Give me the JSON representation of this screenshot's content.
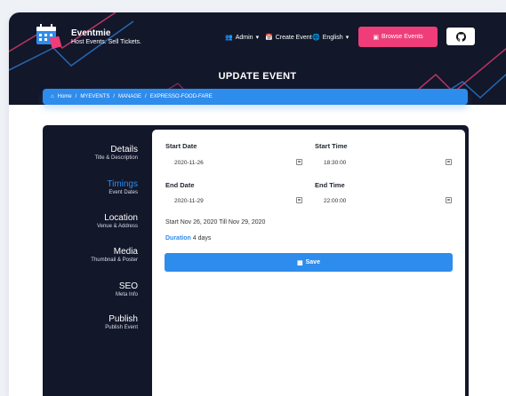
{
  "brand": {
    "name": "Eventmie",
    "tagline": "Host Events. Sell Tickets."
  },
  "nav": {
    "admin": "Admin",
    "create_event": "Create Event",
    "language": "English",
    "browse_events": "Browse Events"
  },
  "page": {
    "title": "UPDATE EVENT"
  },
  "breadcrumb": {
    "items": [
      "Home",
      "MYEVENTS",
      "MANAGE",
      "EXPRESSO-FOOD-FARE"
    ],
    "sep": "/"
  },
  "sidebar": {
    "items": [
      {
        "title": "Details",
        "subtitle": "Title & Description",
        "active": false
      },
      {
        "title": "Timings",
        "subtitle": "Event Dates",
        "active": true
      },
      {
        "title": "Location",
        "subtitle": "Venue & Address",
        "active": false
      },
      {
        "title": "Media",
        "subtitle": "Thumbnail & Poster",
        "active": false
      },
      {
        "title": "SEO",
        "subtitle": "Meta Info",
        "active": false
      },
      {
        "title": "Publish",
        "subtitle": "Publish Event",
        "active": false
      }
    ]
  },
  "form": {
    "start_date": {
      "label": "Start Date",
      "value": "2020-11-26"
    },
    "start_time": {
      "label": "Start Time",
      "value": "18:30:00"
    },
    "end_date": {
      "label": "End Date",
      "value": "2020-11-29"
    },
    "end_time": {
      "label": "End Time",
      "value": "22:00:00"
    },
    "summary": "Start Nov 26, 2020 Till Nov 29, 2020",
    "duration_label": "Duration",
    "duration_value": "4 days",
    "save_label": "Save"
  },
  "colors": {
    "accent": "#2e8cec",
    "brand": "#ef3d7a",
    "dark": "#13172a"
  }
}
